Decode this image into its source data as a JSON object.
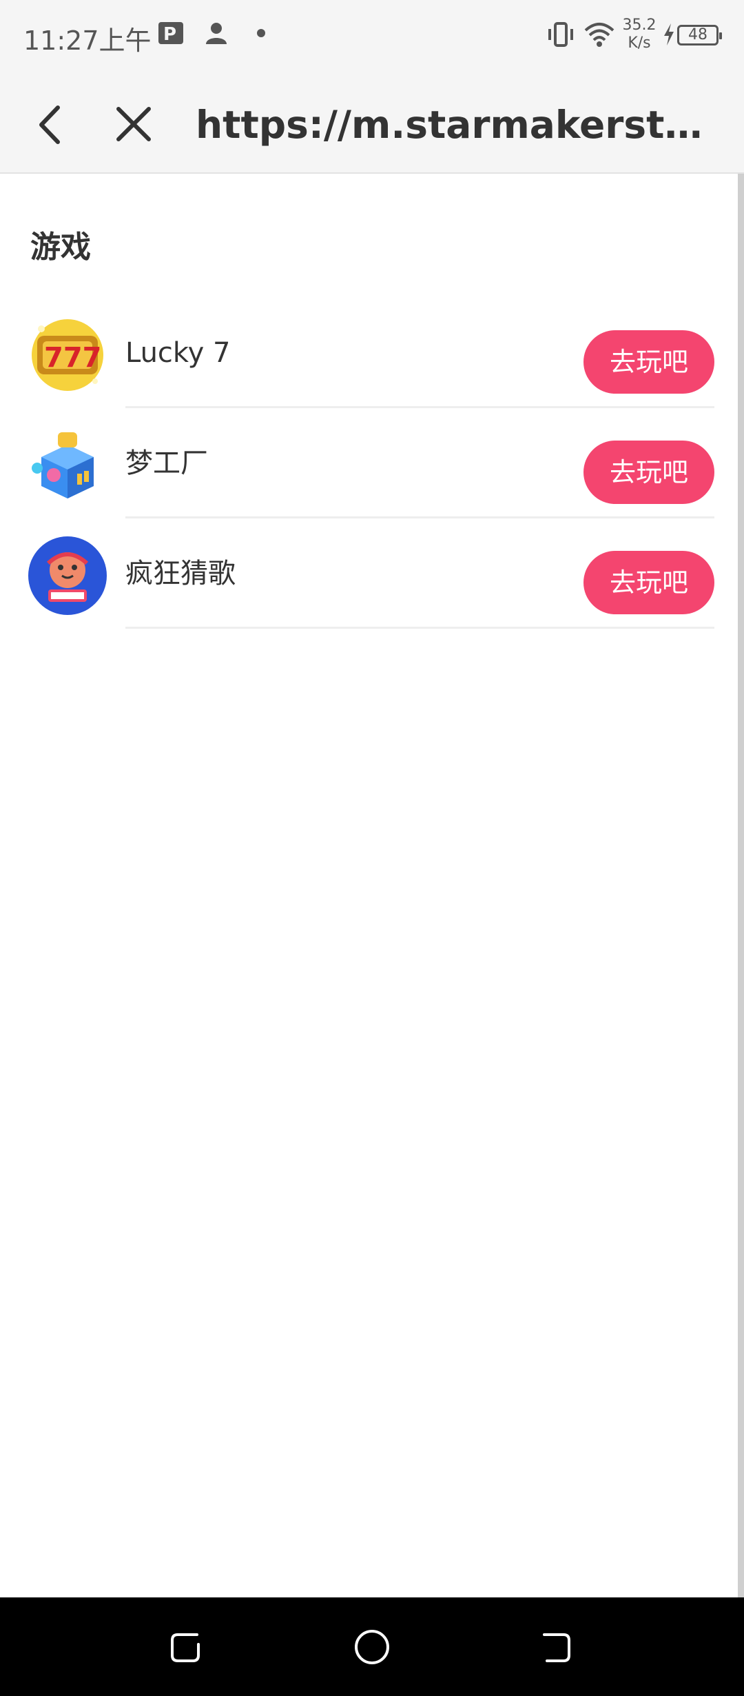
{
  "status_bar": {
    "time": "11:27上午",
    "net_speed_value": "35.2",
    "net_speed_unit": "K/s",
    "battery": "48"
  },
  "toolbar": {
    "back_icon": "chevron-left-icon",
    "close_icon": "close-icon",
    "url": "https://m.starmakerstudios.com"
  },
  "section": {
    "title": "游戏"
  },
  "games": [
    {
      "name": "Lucky 7",
      "button": "去玩吧",
      "icon": "lucky7-slot-icon"
    },
    {
      "name": "梦工厂",
      "button": "去玩吧",
      "icon": "dream-factory-cube-icon"
    },
    {
      "name": "疯狂猜歌",
      "button": "去玩吧",
      "icon": "crazy-guess-song-icon"
    }
  ],
  "colors": {
    "accent": "#f4456f",
    "background": "#ffffff",
    "bar_background": "#f5f5f5"
  }
}
